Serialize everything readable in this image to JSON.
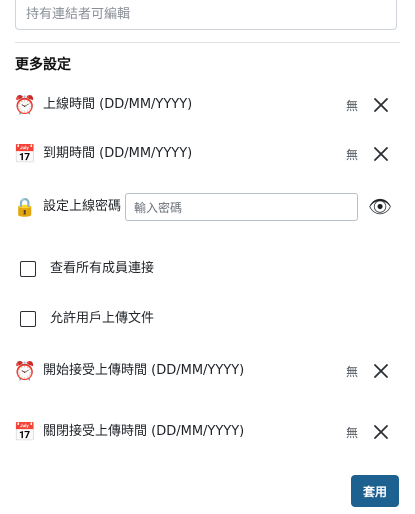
{
  "top_input": {
    "placeholder": "持有連結者可編輯"
  },
  "section": {
    "title": "更多設定"
  },
  "rows": {
    "online_time": {
      "icon": "alarm-clock-icon",
      "label": "上線時間 (DD/MM/YYYY)",
      "value": "無"
    },
    "expire_time": {
      "icon": "calendar-icon",
      "label": "到期時間 (DD/MM/YYYY)",
      "value": "無"
    },
    "password": {
      "icon": "lock-icon",
      "label": "設定上線密碼",
      "placeholder": "輸入密碼",
      "toggle_icon": "eye-icon"
    },
    "view_members": {
      "label": "查看所有成員連接",
      "checked": false
    },
    "allow_upload": {
      "label": "允許用戶上傳文件",
      "checked": false
    },
    "upload_start": {
      "icon": "alarm-clock-icon",
      "label": "開始接受上傳時間 (DD/MM/YYYY)",
      "value": "無"
    },
    "upload_end": {
      "icon": "calendar-icon",
      "label": "關閉接受上傳時間 (DD/MM/YYYY)",
      "value": "無"
    }
  },
  "apply_button": {
    "label": "套用"
  },
  "colors": {
    "accent": "#1d6190",
    "divider": "#dfe3e7"
  }
}
